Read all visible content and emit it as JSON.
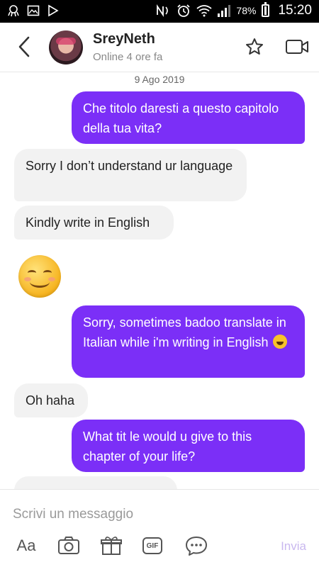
{
  "status_bar": {
    "battery": "78%",
    "time": "15:20"
  },
  "header": {
    "contact_name": "SreyNeth",
    "contact_status": "Online 4 ore fa"
  },
  "chat": {
    "date": "9 Ago 2019",
    "messages": [
      {
        "dir": "out",
        "text": "Che titolo daresti a questo capitolo della tua vita?"
      },
      {
        "dir": "in",
        "text": "Sorry I don’t understand ur language"
      },
      {
        "dir": "in",
        "text": "Kindly write in English"
      },
      {
        "dir": "in",
        "text": "😊"
      },
      {
        "dir": "out",
        "text": "Sorry, sometimes badoo translate in Italian while i'm writing in English"
      },
      {
        "dir": "in",
        "text": "Oh haha"
      },
      {
        "dir": "out",
        "text": "What tit le would u give to this chapter of your life?"
      }
    ]
  },
  "composer": {
    "placeholder": "Scrivi un messaggio",
    "send_label": "Invia",
    "gif_label": "GIF",
    "font_label": "Aa"
  },
  "colors": {
    "accent": "#7b2ff7",
    "incoming": "#f2f2f2",
    "send_disabled": "#c9b8ef"
  }
}
